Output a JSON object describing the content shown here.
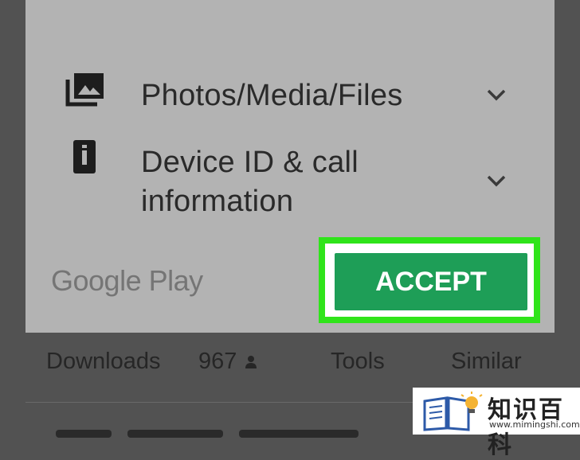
{
  "dialog": {
    "permissions": [
      {
        "icon": "photo-library-icon",
        "lines": [
          "Photos/Media/Files"
        ]
      },
      {
        "icon": "device-id-icon",
        "lines": [
          "Device ID & call",
          "information"
        ]
      }
    ],
    "brand": "Google Play",
    "accept_label": "ACCEPT"
  },
  "highlight_color": "#2fe41a",
  "accept_color": "#1e9e57",
  "stats_row": {
    "downloads_label": "Downloads",
    "count": "967",
    "tools_label": "Tools",
    "similar_label": "Similar"
  },
  "watermark": {
    "cn_text": "知识百科",
    "url": "www.mimingshi.com"
  }
}
